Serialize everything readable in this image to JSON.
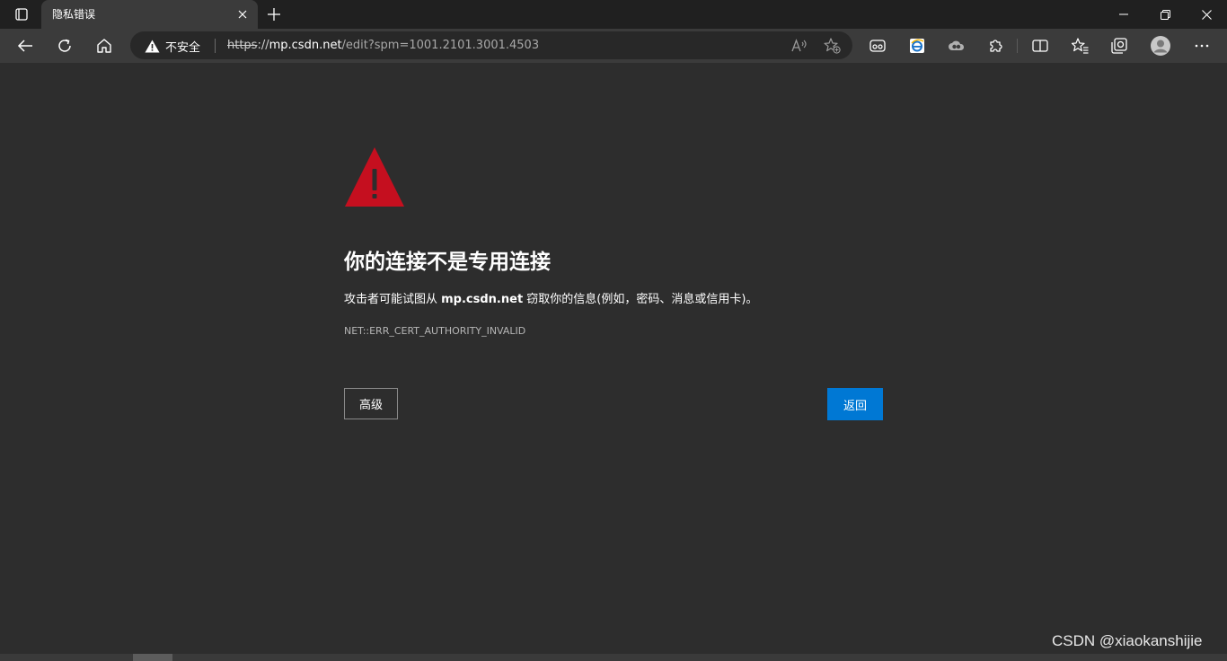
{
  "tab": {
    "title": "隐私错误"
  },
  "addressbar": {
    "security_label": "不安全",
    "url_scheme": "https",
    "url_sep": "://",
    "url_host": "mp.csdn.net",
    "url_path": "/edit?spm=1001.2101.3001.4503"
  },
  "error_page": {
    "heading": "你的连接不是专用连接",
    "desc_before": "攻击者可能试图从 ",
    "desc_host": "mp.csdn.net",
    "desc_after": " 窃取你的信息(例如，密码、消息或信用卡)。",
    "error_code": "NET::ERR_CERT_AUTHORITY_INVALID",
    "advanced_label": "高级",
    "back_label": "返回"
  },
  "watermark": "CSDN @xiaokanshijie",
  "colors": {
    "background": "#2d2d2d",
    "accent": "#0078d4",
    "warning": "#c50f1f"
  }
}
